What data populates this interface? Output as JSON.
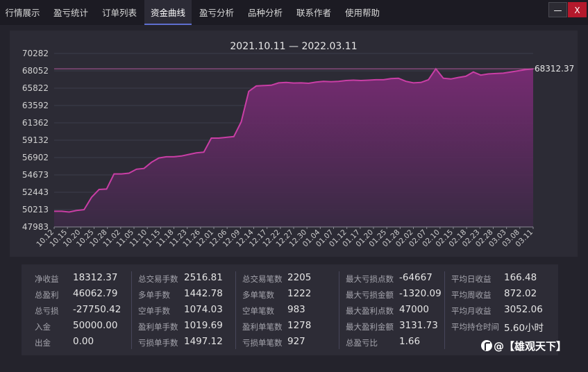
{
  "tabs": [
    {
      "label": "行情展示",
      "active": false
    },
    {
      "label": "盈亏统计",
      "active": false
    },
    {
      "label": "订单列表",
      "active": false
    },
    {
      "label": "资金曲线",
      "active": true
    },
    {
      "label": "盈亏分析",
      "active": false
    },
    {
      "label": "品种分析",
      "active": false
    },
    {
      "label": "联系作者",
      "active": false
    },
    {
      "label": "使用帮助",
      "active": false
    }
  ],
  "window": {
    "minimize_label": "—",
    "close_label": "X"
  },
  "chart_data": {
    "type": "area",
    "title": "2021.10.11 — 2022.03.11",
    "y_ticks": [
      70282,
      68052,
      65822,
      63592,
      61362,
      59132,
      56902,
      54673,
      52443,
      50213,
      47983
    ],
    "ylim": [
      47983,
      70282
    ],
    "x_ticks": [
      "10.12",
      "10.15",
      "10.20",
      "10.25",
      "10.28",
      "11.02",
      "11.05",
      "11.10",
      "11.15",
      "11.18",
      "11.23",
      "11.26",
      "12.01",
      "12.06",
      "12.09",
      "12.14",
      "12.17",
      "12.22",
      "12.27",
      "12.30",
      "01.04",
      "01.07",
      "01.12",
      "01.17",
      "01.20",
      "01.25",
      "01.28",
      "02.02",
      "02.07",
      "02.10",
      "02.15",
      "02.18",
      "02.23",
      "02.28",
      "03.03",
      "03.08",
      "03.11"
    ],
    "reference_line": 68312.37,
    "reference_label": "68312.37",
    "series": [
      {
        "values": [
          50000,
          50000,
          49900,
          50100,
          50200,
          51800,
          52800,
          52850,
          54800,
          54800,
          54900,
          55400,
          55500,
          56300,
          56850,
          57000,
          57000,
          57100,
          57300,
          57500,
          57600,
          59400,
          59400,
          59500,
          59600,
          61500,
          65400,
          66100,
          66150,
          66200,
          66500,
          66550,
          66480,
          66500,
          66450,
          66600,
          66700,
          66650,
          66700,
          66800,
          66850,
          66800,
          66850,
          66900,
          66900,
          67050,
          67100,
          66700,
          66500,
          66550,
          66900,
          68300,
          67100,
          67000,
          67200,
          67350,
          67900,
          67500,
          67650,
          67700,
          67750,
          67900,
          68050,
          68200,
          68300
        ]
      }
    ]
  },
  "stats": [
    [
      {
        "label": "净收益",
        "value": "18312.37"
      },
      {
        "label": "总盈利",
        "value": "46062.79"
      },
      {
        "label": "总亏损",
        "value": "-27750.42"
      },
      {
        "label": "入金",
        "value": "50000.00"
      },
      {
        "label": "出金",
        "value": "0.00"
      }
    ],
    [
      {
        "label": "总交易手数",
        "value": "2516.81"
      },
      {
        "label": "多单手数",
        "value": "1442.78"
      },
      {
        "label": "空单手数",
        "value": "1074.03"
      },
      {
        "label": "盈利单手数",
        "value": "1019.69"
      },
      {
        "label": "亏损单手数",
        "value": "1497.12"
      }
    ],
    [
      {
        "label": "总交易笔数",
        "value": "2205"
      },
      {
        "label": "多单笔数",
        "value": "1222"
      },
      {
        "label": "空单笔数",
        "value": "983"
      },
      {
        "label": "盈利单笔数",
        "value": "1278"
      },
      {
        "label": "亏损单笔数",
        "value": "927"
      }
    ],
    [
      {
        "label": "最大亏损点数",
        "value": "-64667"
      },
      {
        "label": "最大亏损金额",
        "value": "-1320.09"
      },
      {
        "label": "最大盈利点数",
        "value": "47000"
      },
      {
        "label": "最大盈利金额",
        "value": "3131.73"
      },
      {
        "label": "总盈亏比",
        "value": "1.66"
      }
    ],
    [
      {
        "label": "平均日收益",
        "value": "166.48"
      },
      {
        "label": "平均周收益",
        "value": "872.02"
      },
      {
        "label": "平均月收益",
        "value": "3052.06"
      },
      {
        "label": "平均持仓时间",
        "value": "5.60小时"
      }
    ]
  ],
  "watermark": {
    "icon": "logo-icon",
    "text": "@【雄观天下】"
  },
  "colors": {
    "line": "#c93ea5",
    "fill_top": "#7a2b75",
    "fill_bottom": "#3a2a44",
    "reference": "#b45a9e",
    "accent": "#5e6fd0"
  }
}
